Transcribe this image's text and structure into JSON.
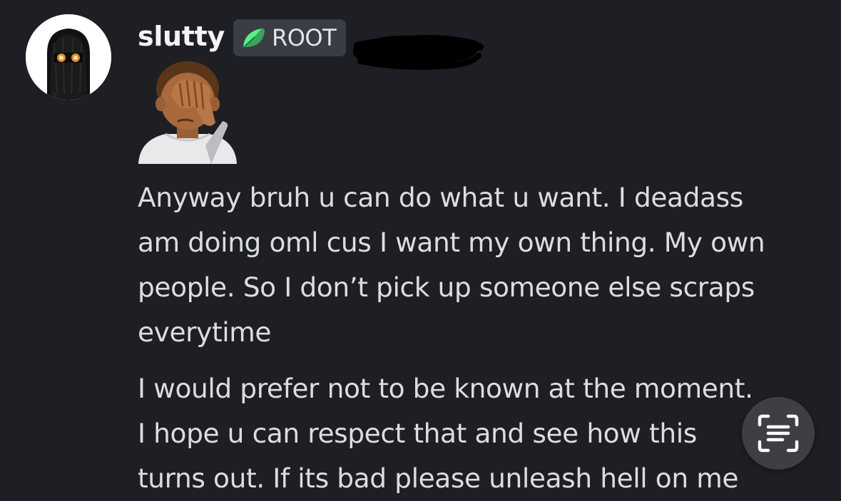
{
  "message": {
    "author": {
      "username": "slutty",
      "role_label": "ROOT",
      "role_color": "#3ba55c"
    },
    "emoji": "facepalm-emoji",
    "paragraphs": [
      {
        "lines": [
          "Anyway bruh u can do what u want. I deadass",
          "am doing oml cus I want my own thing. My own",
          "people. So I don’t pick up someone else scraps",
          "everytime"
        ]
      },
      {
        "lines": [
          "I would prefer not to be known at the moment.",
          "I hope u can respect that and see how this",
          "turns out. If its bad please unleash hell on me"
        ]
      }
    ]
  },
  "overlay": {
    "live_text_button_icon": "text-scan-icon"
  },
  "colors": {
    "background": "#1e1f24",
    "username": "#f2f3f5",
    "message_text": "#dbdee1",
    "badge_background": "#3a3d44"
  }
}
